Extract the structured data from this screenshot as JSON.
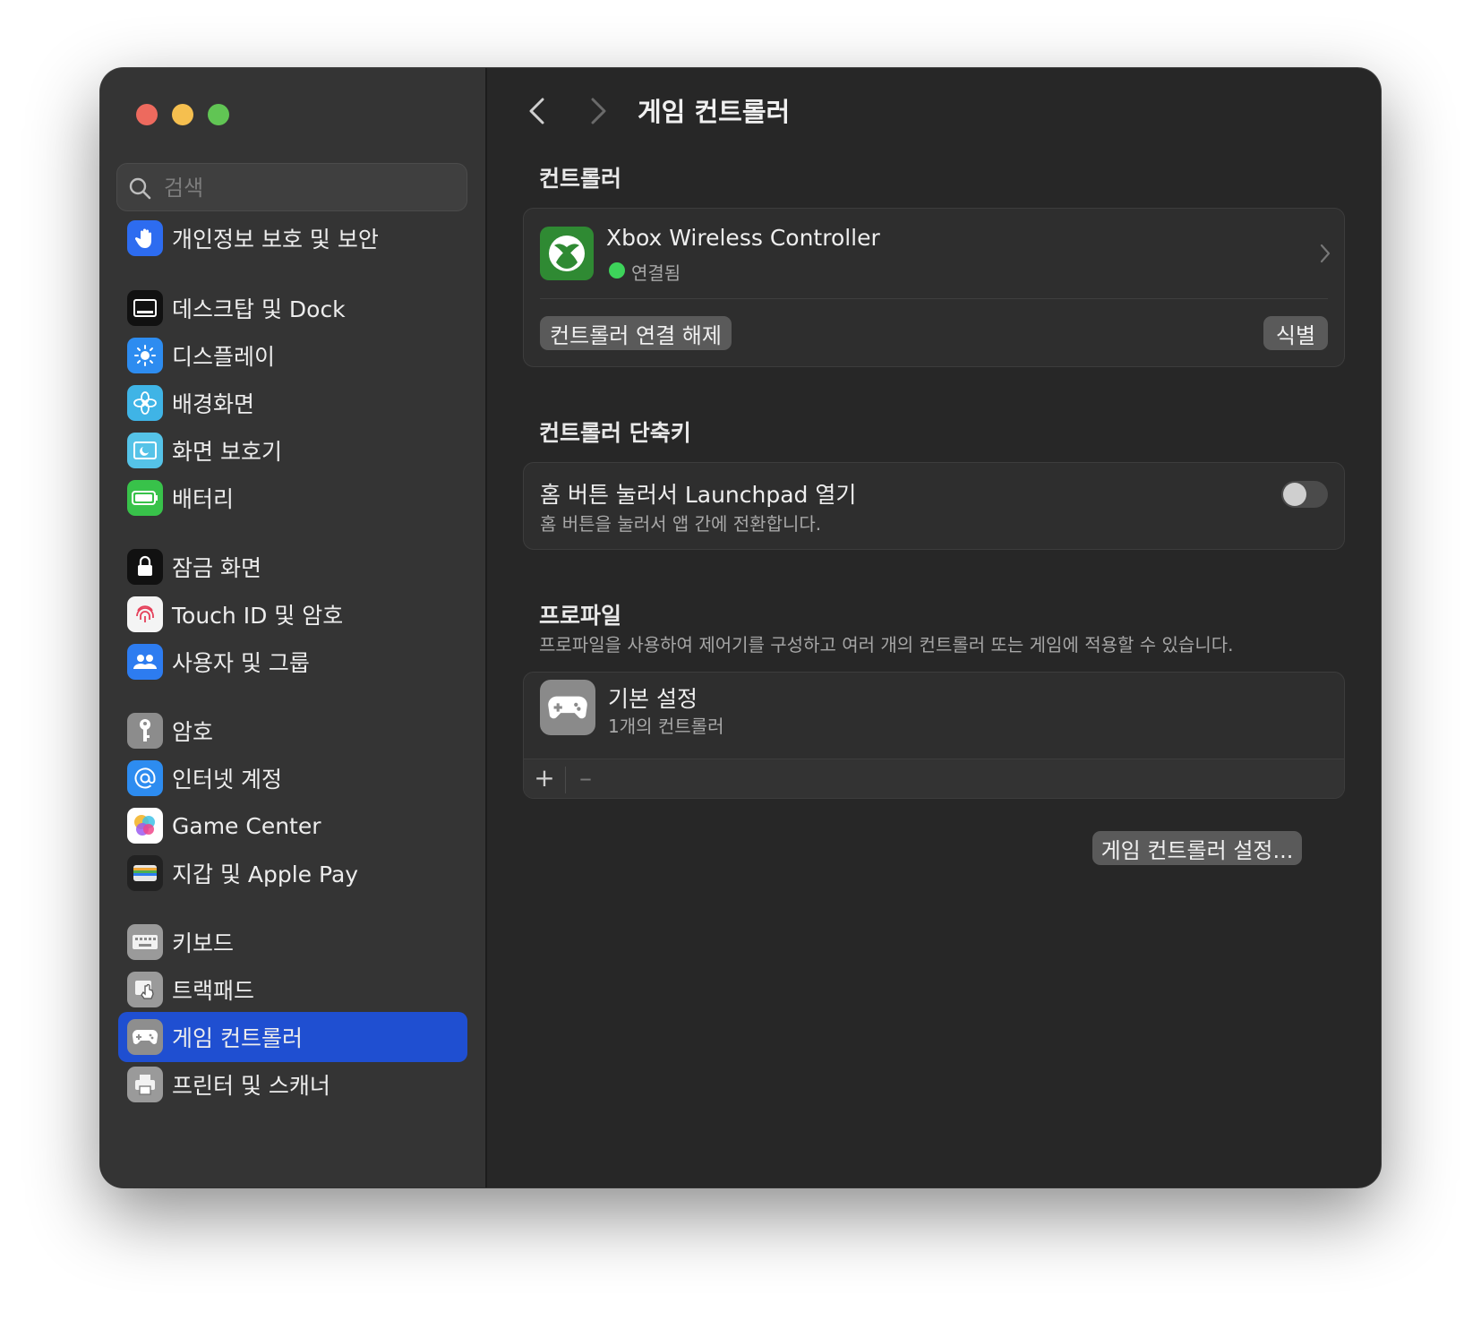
{
  "window": {
    "title": "게임 컨트롤러"
  },
  "search": {
    "placeholder": "검색"
  },
  "sidebar": {
    "items": [
      {
        "label": "개인정보 보호 및 보안",
        "icon": "hand-icon",
        "color": "#2d6cf0"
      },
      {
        "label": "데스크탑 및 Dock",
        "icon": "dock-icon",
        "color": "#111111"
      },
      {
        "label": "디스플레이",
        "icon": "sun-icon",
        "color": "#2d8cf0"
      },
      {
        "label": "배경화면",
        "icon": "flower-icon",
        "color": "#3fb4e6"
      },
      {
        "label": "화면 보호기",
        "icon": "screensaver-icon",
        "color": "#55c3e8"
      },
      {
        "label": "배터리",
        "icon": "battery-icon",
        "color": "#38c24a"
      },
      {
        "label": "잠금 화면",
        "icon": "lock-icon",
        "color": "#111111"
      },
      {
        "label": "Touch ID 및 암호",
        "icon": "fingerprint-icon",
        "color": "#f4f4f4"
      },
      {
        "label": "사용자 및 그룹",
        "icon": "users-icon",
        "color": "#2d7cf0"
      },
      {
        "label": "암호",
        "icon": "key-icon",
        "color": "#8c8c8c"
      },
      {
        "label": "인터넷 계정",
        "icon": "at-icon",
        "color": "#2d8cf0"
      },
      {
        "label": "Game Center",
        "icon": "game-center-icon",
        "color": "#ffffff"
      },
      {
        "label": "지갑 및 Apple Pay",
        "icon": "wallet-icon",
        "color": "#222222"
      },
      {
        "label": "키보드",
        "icon": "keyboard-icon",
        "color": "#9a9a9a"
      },
      {
        "label": "트랙패드",
        "icon": "trackpad-icon",
        "color": "#9a9a9a"
      },
      {
        "label": "게임 컨트롤러",
        "icon": "gamepad-icon",
        "color": "#8e8e8e",
        "active": true
      },
      {
        "label": "프린터 및 스캐너",
        "icon": "printer-icon",
        "color": "#9a9a9a"
      }
    ]
  },
  "controllers": {
    "title": "컨트롤러",
    "device": {
      "name": "Xbox Wireless Controller",
      "status": "연결됨",
      "icon": "xbox-icon",
      "status_color": "#3dd35a"
    },
    "disconnect_label": "컨트롤러 연결 해제",
    "identify_label": "식별"
  },
  "shortcuts": {
    "title": "컨트롤러 단축키",
    "item_title": "홈 버튼 눌러서 Launchpad 열기",
    "item_desc": "홈 버튼을 눌러서 앱 간에 전환합니다.",
    "enabled": false
  },
  "profiles": {
    "title": "프로파일",
    "desc": "프로파일을 사용하여 제어기를 구성하고 여러 개의 컨트롤러 또는 게임에 적용할 수 있습니다.",
    "items": [
      {
        "name": "기본 설정",
        "count": "1개의 컨트롤러",
        "icon": "gamepad-icon"
      }
    ],
    "add_label": "+",
    "remove_label": "–"
  },
  "settings_button": "게임 컨트롤러 설정..."
}
